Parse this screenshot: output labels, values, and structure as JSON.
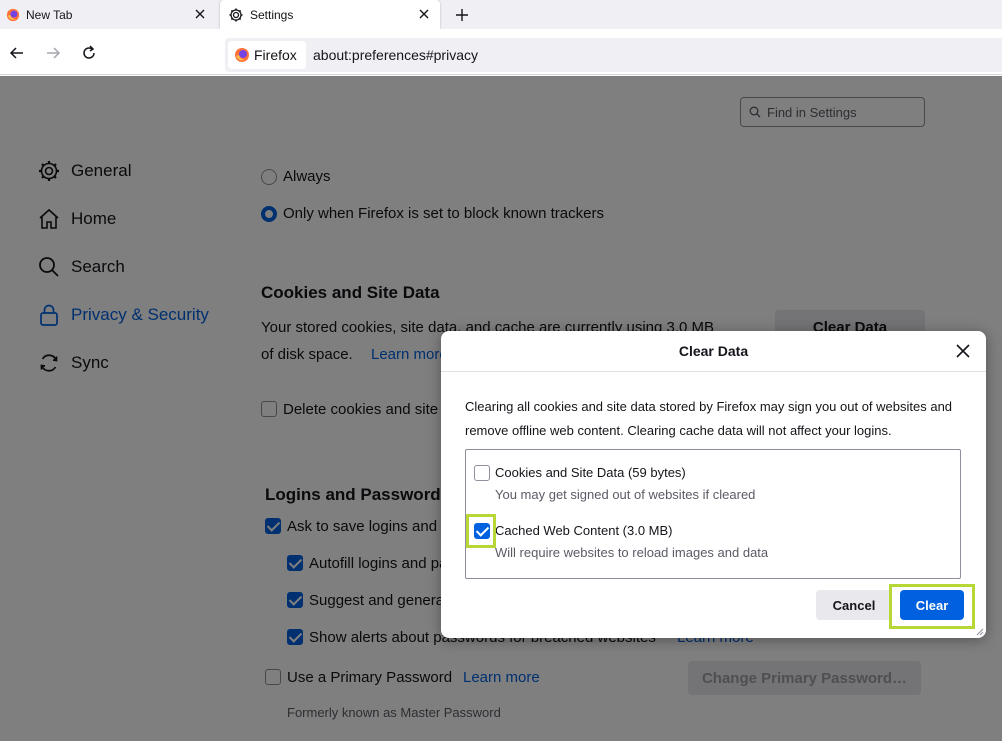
{
  "tabs": [
    {
      "title": "New Tab",
      "icon": "firefox-icon"
    },
    {
      "title": "Settings",
      "icon": "gear-icon"
    }
  ],
  "urlbar": {
    "identity": "Firefox",
    "url": "about:preferences#privacy"
  },
  "search": {
    "placeholder": "Find in Settings"
  },
  "sidebar": {
    "items": [
      {
        "label": "General",
        "icon": "gear-icon"
      },
      {
        "label": "Home",
        "icon": "home-icon"
      },
      {
        "label": "Search",
        "icon": "search-icon"
      },
      {
        "label": "Privacy & Security",
        "icon": "lock-icon",
        "active": true
      },
      {
        "label": "Sync",
        "icon": "sync-icon"
      }
    ]
  },
  "content": {
    "radio_always": "Always",
    "radio_trackers": "Only when Firefox is set to block known trackers",
    "cookies": {
      "heading": "Cookies and Site Data",
      "line1": "Your stored cookies, site data, and cache are currently using 3.0 MB",
      "line2": "of disk space.",
      "learn_more": "Learn more",
      "clear_button": "Clear Data",
      "delete_on_close": "Delete cookies and site data when Firefox is closed"
    },
    "logins": {
      "heading": "Logins and Passwords",
      "ask_save": "Ask to save logins and passwords for websites",
      "autofill": "Autofill logins and passwords",
      "suggest": "Suggest and generate strong passwords",
      "alerts": "Show alerts about passwords for breached websites",
      "alerts_learn_more": "Learn more",
      "primary_password": "Use a Primary Password",
      "primary_learn_more": "Learn more",
      "change_primary_button": "Change Primary Password…",
      "formerly": "Formerly known as Master Password"
    }
  },
  "dialog": {
    "title": "Clear Data",
    "description": "Clearing all cookies and site data stored by Firefox may sign you out of websites and remove offline web content. Clearing cache data will not affect your logins.",
    "options": [
      {
        "label": "Cookies and Site Data (59 bytes)",
        "sub": "You may get signed out of websites if cleared",
        "checked": false
      },
      {
        "label": "Cached Web Content (3.0 MB)",
        "sub": "Will require websites to reload images and data",
        "checked": true
      }
    ],
    "cancel": "Cancel",
    "clear": "Clear"
  },
  "colors": {
    "accent": "#0061e0",
    "highlight": "#b6d736"
  }
}
